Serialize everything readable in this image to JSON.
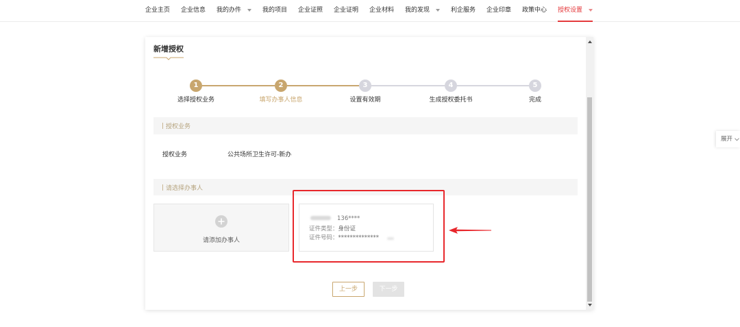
{
  "colors": {
    "accent_gold": "#c8a66e",
    "step_pending_gray": "#d6d6de",
    "nav_active_red": "#e4393c",
    "highlight_red": "#e8262b"
  },
  "nav": {
    "items": [
      {
        "label": "企业主页",
        "dropdown": false
      },
      {
        "label": "企业信息",
        "dropdown": false
      },
      {
        "label": "我的办件",
        "dropdown": true,
        "icon": "caret-down-icon"
      },
      {
        "label": "我的项目",
        "dropdown": false
      },
      {
        "label": "企业证照",
        "dropdown": false
      },
      {
        "label": "企业证明",
        "dropdown": false
      },
      {
        "label": "企业材料",
        "dropdown": false
      },
      {
        "label": "我的发现",
        "dropdown": true,
        "icon": "caret-down-icon"
      },
      {
        "label": "利企服务",
        "dropdown": false
      },
      {
        "label": "企业印章",
        "dropdown": false
      },
      {
        "label": "政策中心",
        "dropdown": false
      },
      {
        "label": "授权设置",
        "dropdown": true,
        "icon": "caret-down-icon",
        "active": true
      }
    ]
  },
  "page": {
    "title": "新增授权"
  },
  "stepper": {
    "steps": [
      {
        "number": "1",
        "label": "选择授权业务",
        "reached": true,
        "current": false
      },
      {
        "number": "2",
        "label": "填写办事人信息",
        "reached": true,
        "current": true
      },
      {
        "number": "3",
        "label": "设置有效期",
        "reached": false,
        "current": false
      },
      {
        "number": "4",
        "label": "生成授权委托书",
        "reached": false,
        "current": false
      },
      {
        "number": "5",
        "label": "完成",
        "reached": false,
        "current": false
      }
    ]
  },
  "business_section": {
    "header": "授权业务",
    "field_label": "授权业务",
    "field_value": "公共场所卫生许可-新办"
  },
  "agent_section": {
    "header": "请选择办事人",
    "add_card": {
      "label": "请添加办事人",
      "icon": "plus-circle-icon"
    },
    "agent_card": {
      "phone": "136****",
      "id_type_label": "证件类型：",
      "id_type": "身份证",
      "id_number_label": "证件号码：",
      "id_number": "**************"
    }
  },
  "annotation": {
    "arrow_icon": "arrow-left-icon",
    "highlight_color": "#e8262b"
  },
  "actions": {
    "prev_label": "上一步",
    "next_label": "下一步",
    "next_disabled": true
  },
  "side_tab": {
    "label": "展开",
    "icon": "chevron-down-icon"
  }
}
